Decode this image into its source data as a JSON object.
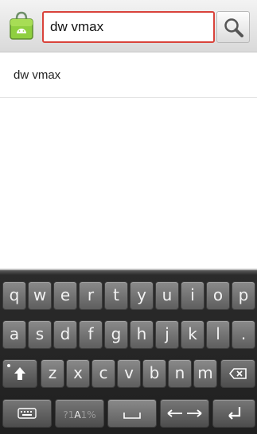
{
  "header": {
    "app_icon": "market-bag-icon",
    "search_value": "dw vmax",
    "search_button_icon": "magnifier-icon"
  },
  "suggestions": [
    {
      "label": "dw vmax"
    }
  ],
  "keyboard": {
    "row1": [
      "q",
      "w",
      "e",
      "r",
      "t",
      "y",
      "u",
      "i",
      "o",
      "p"
    ],
    "row2": [
      "a",
      "s",
      "d",
      "f",
      "g",
      "h",
      "j",
      "k",
      "l",
      "."
    ],
    "row3": [
      "z",
      "x",
      "c",
      "v",
      "b",
      "n",
      "m"
    ],
    "symbol_key": {
      "prefix": "?1",
      "main": "A",
      "suffix": "1%"
    },
    "icons": {
      "shift": "shift-arrow-icon",
      "delete": "backspace-icon",
      "keyboard_settings": "keyboard-icon",
      "space": "space-bar-icon",
      "cursor_move": "left-right-arrows-icon",
      "enter": "enter-icon"
    }
  }
}
